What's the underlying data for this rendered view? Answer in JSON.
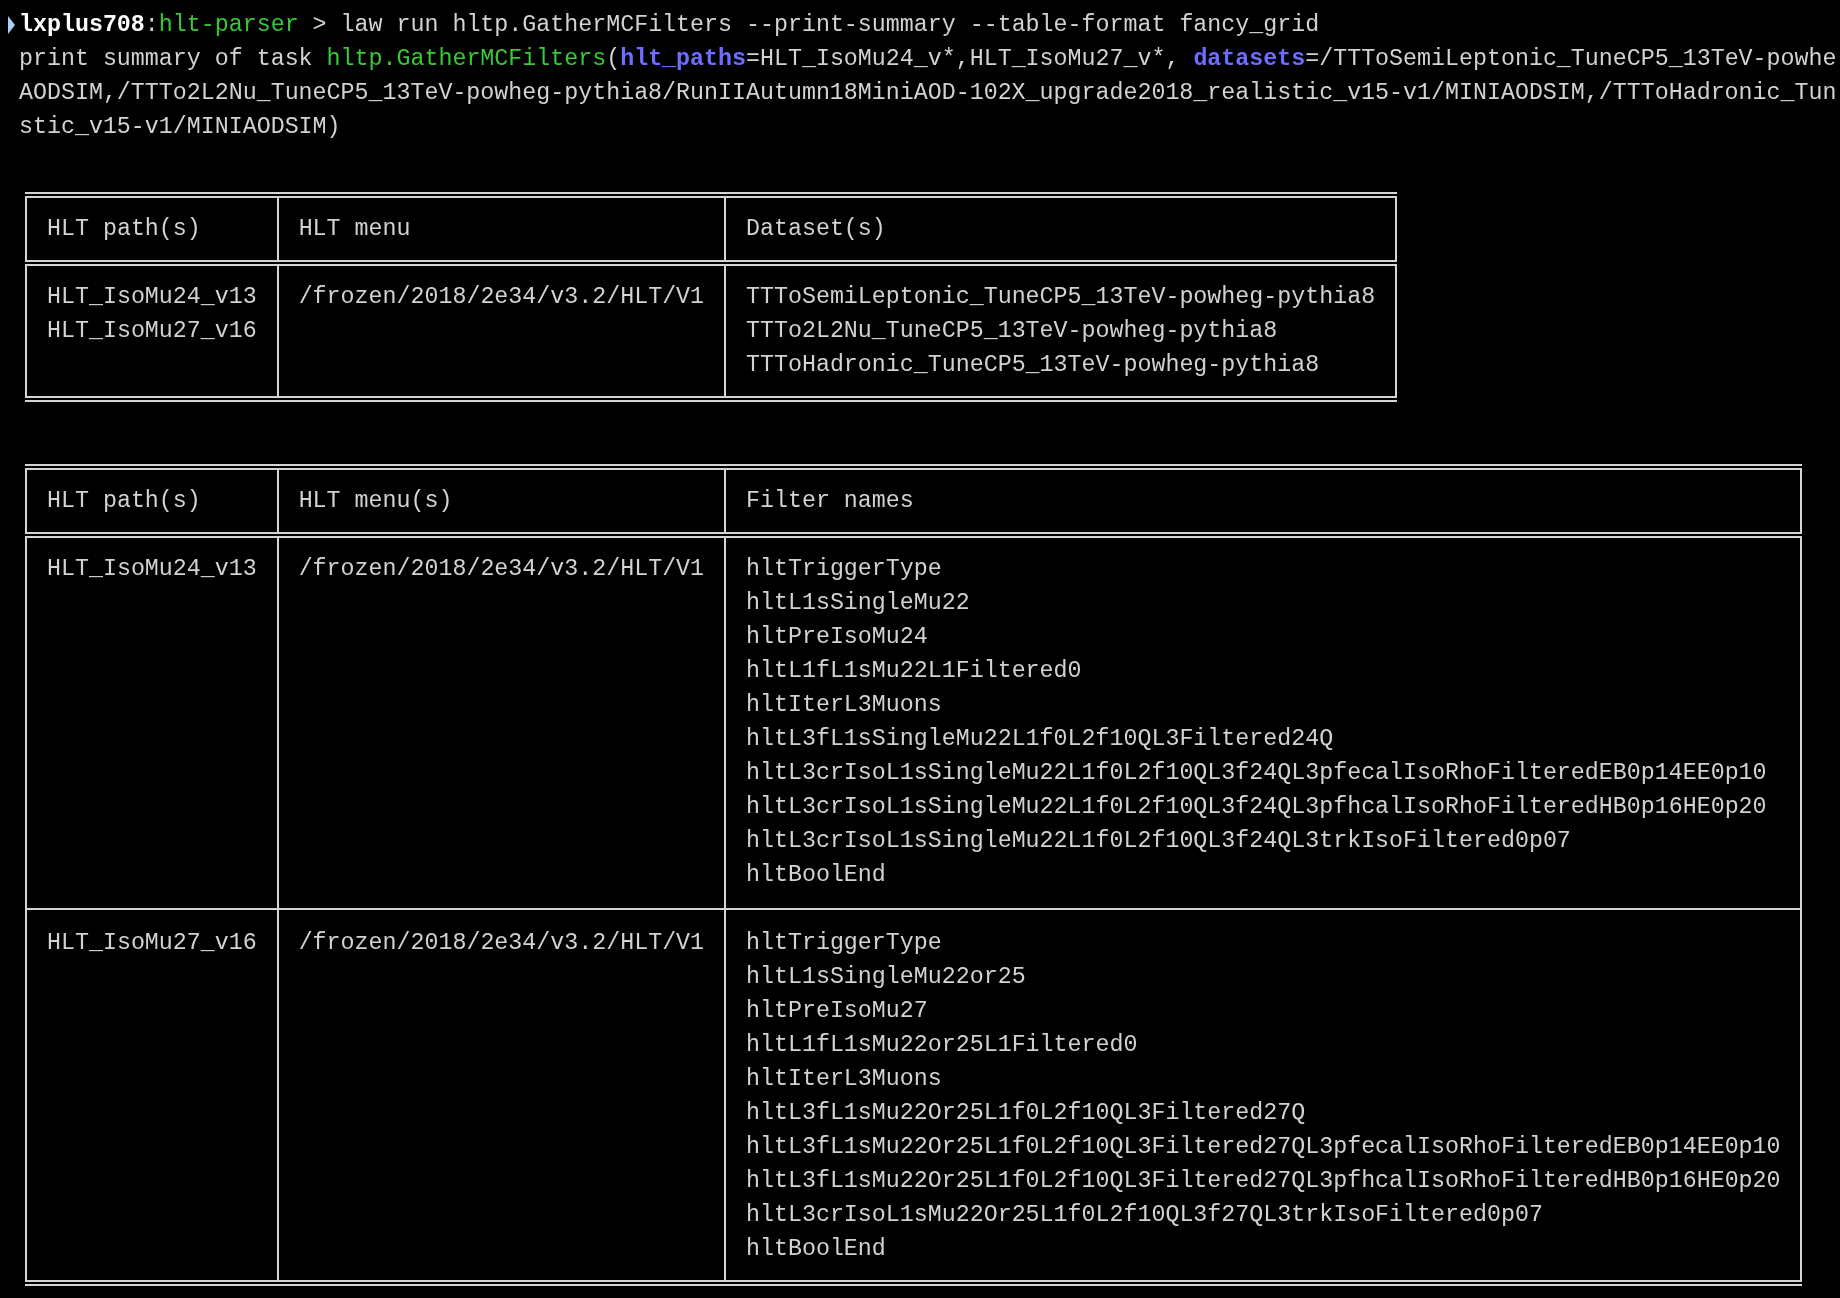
{
  "terminal": {
    "command_line": {
      "segments": [
        {
          "kind": "host",
          "text": "lxplus708"
        },
        {
          "kind": "plain",
          "text": ":"
        },
        {
          "kind": "directory",
          "text": "hlt-parser"
        },
        {
          "kind": "plain",
          "text": " > law run hltp.GatherMCFilters --print-summary --table-format fancy_grid"
        }
      ]
    },
    "output_lines": [
      {
        "segments": [
          {
            "kind": "plain",
            "text": "print summary of task "
          },
          {
            "kind": "task",
            "text": "hltp.GatherMCFilters"
          },
          {
            "kind": "plain",
            "text": "("
          },
          {
            "kind": "param",
            "text": "hlt_paths"
          },
          {
            "kind": "plain",
            "text": "=HLT_IsoMu24_v*,HLT_IsoMu27_v*, "
          },
          {
            "kind": "param",
            "text": "datasets"
          },
          {
            "kind": "plain",
            "text": "=/TTToSemiLeptonic_TuneCP5_13TeV-powhe"
          }
        ]
      },
      {
        "segments": [
          {
            "kind": "plain",
            "text": "AODSIM,/TTTo2L2Nu_TuneCP5_13TeV-powheg-pythia8/RunIIAutumn18MiniAOD-102X_upgrade2018_realistic_v15-v1/MINIAODSIM,/TTToHadronic_Tun"
          }
        ]
      },
      {
        "segments": [
          {
            "kind": "plain",
            "text": "stic_v15-v1/MINIAODSIM)"
          }
        ]
      }
    ]
  },
  "tables": [
    {
      "columns": [
        "HLT path(s)",
        "HLT menu",
        "Dataset(s)"
      ],
      "rows": [
        {
          "cells": [
            [
              "HLT_IsoMu24_v13",
              "HLT_IsoMu27_v16"
            ],
            [
              "/frozen/2018/2e34/v3.2/HLT/V1"
            ],
            [
              "TTToSemiLeptonic_TuneCP5_13TeV-powheg-pythia8",
              "TTTo2L2Nu_TuneCP5_13TeV-powheg-pythia8",
              "TTToHadronic_TuneCP5_13TeV-powheg-pythia8"
            ]
          ]
        }
      ]
    },
    {
      "columns": [
        "HLT path(s)",
        "HLT menu(s)",
        "Filter names"
      ],
      "rows": [
        {
          "cells": [
            [
              "HLT_IsoMu24_v13"
            ],
            [
              "/frozen/2018/2e34/v3.2/HLT/V1"
            ],
            [
              "hltTriggerType",
              "hltL1sSingleMu22",
              "hltPreIsoMu24",
              "hltL1fL1sMu22L1Filtered0",
              "hltIterL3Muons",
              "hltL3fL1sSingleMu22L1f0L2f10QL3Filtered24Q",
              "hltL3crIsoL1sSingleMu22L1f0L2f10QL3f24QL3pfecalIsoRhoFilteredEB0p14EE0p10",
              "hltL3crIsoL1sSingleMu22L1f0L2f10QL3f24QL3pfhcalIsoRhoFilteredHB0p16HE0p20",
              "hltL3crIsoL1sSingleMu22L1f0L2f10QL3f24QL3trkIsoFiltered0p07",
              "hltBoolEnd"
            ]
          ]
        },
        {
          "cells": [
            [
              "HLT_IsoMu27_v16"
            ],
            [
              "/frozen/2018/2e34/v3.2/HLT/V1"
            ],
            [
              "hltTriggerType",
              "hltL1sSingleMu22or25",
              "hltPreIsoMu27",
              "hltL1fL1sMu22or25L1Filtered0",
              "hltIterL3Muons",
              "hltL3fL1sMu22Or25L1f0L2f10QL3Filtered27Q",
              "hltL3fL1sMu22Or25L1f0L2f10QL3Filtered27QL3pfecalIsoRhoFilteredEB0p14EE0p10",
              "hltL3fL1sMu22Or25L1f0L2f10QL3Filtered27QL3pfhcalIsoRhoFilteredHB0p16HE0p20",
              "hltL3crIsoL1sMu22Or25L1f0L2f10QL3f27QL3trkIsoFiltered0p07",
              "hltBoolEnd"
            ]
          ]
        }
      ]
    }
  ]
}
